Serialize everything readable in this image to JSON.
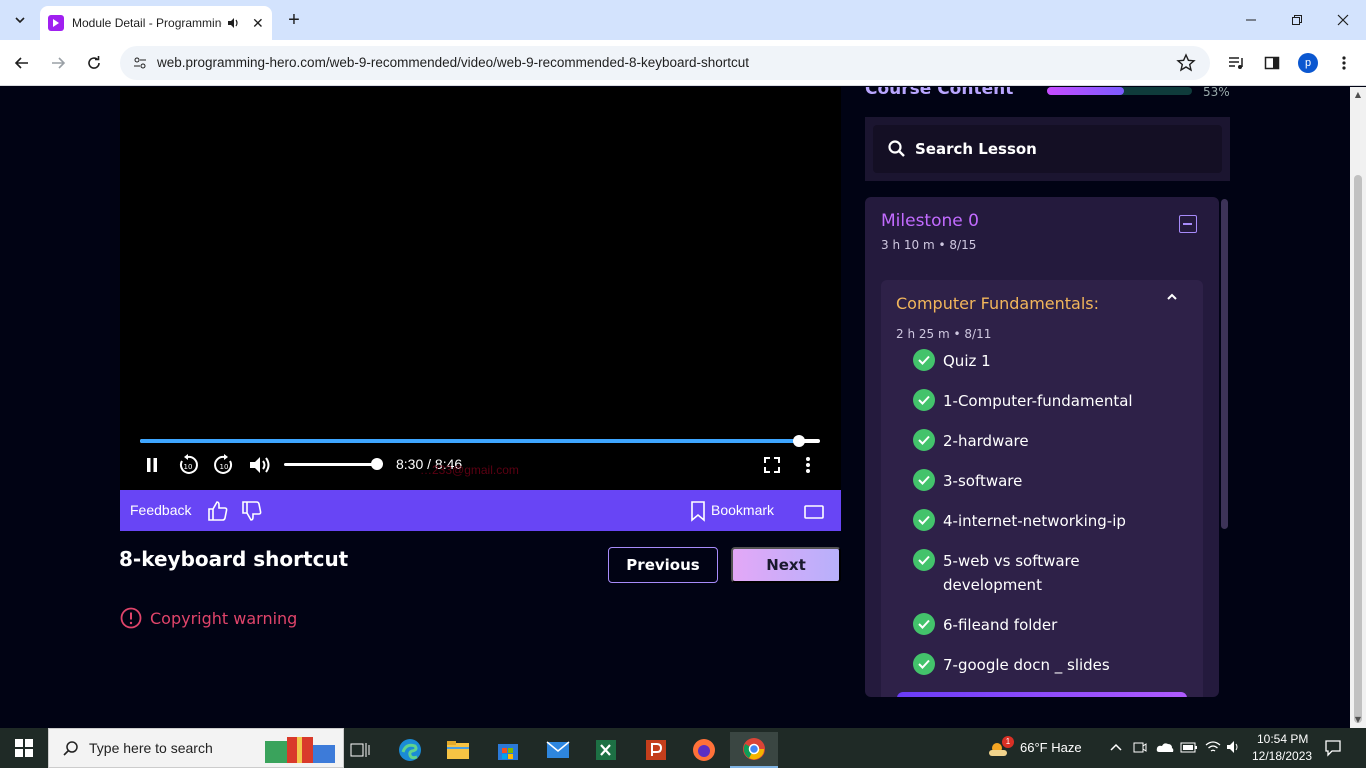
{
  "browser": {
    "tab_title": "Module Detail - Programming Hero",
    "tab_close": "✕",
    "new_tab": "+",
    "url": "web.programming-hero.com/web-9-recommended/video/web-9-recommended-8-keyboard-shortcut",
    "profile_letter": "p"
  },
  "player": {
    "time": "8:30 / 8:46",
    "progress_fraction": 0.969,
    "volume_fraction": 1.0,
    "watermark": "…233@gmail.com"
  },
  "feedback_bar": {
    "feedback_label": "Feedback",
    "bookmark_label": "Bookmark"
  },
  "lesson": {
    "title": "8-keyboard shortcut",
    "previous_label": "Previous",
    "next_label": "Next",
    "copyright_warning": "Copyright warning"
  },
  "sidebar": {
    "course_content_label": "Course Content",
    "progress_percent": "53%",
    "progress_fraction": 0.53,
    "search_placeholder": "Search Lesson",
    "milestone": {
      "title": "Milestone 0",
      "duration": "3 h 10 m",
      "count": "8/15"
    },
    "module": {
      "title": "Computer Fundamentals:",
      "duration": "2 h 25 m",
      "count": "8/11",
      "lessons": [
        "Quiz 1",
        "1-Computer-fundamental",
        "2-hardware",
        "3-software",
        "4-internet-networking-ip",
        "5-web vs software development",
        "6-fileand folder",
        "7-google docn _ slides"
      ]
    }
  },
  "taskbar": {
    "search_placeholder": "Type here to search",
    "weather": "66°F  Haze",
    "weather_badge": "1",
    "time": "10:54 PM",
    "date": "12/18/2023"
  },
  "colors": {
    "accent_purple": "#6845f5",
    "check_green": "#43c36b",
    "warning_red": "#e0446a",
    "module_title": "#f2b65b",
    "milestone_title": "#c26bff"
  }
}
